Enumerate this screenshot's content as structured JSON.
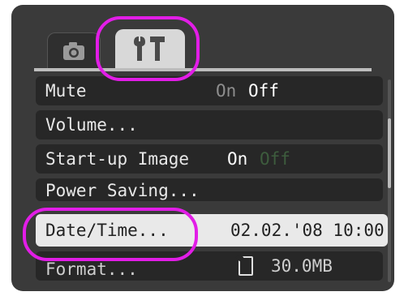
{
  "tabs": [
    {
      "icon": "camera-icon",
      "active": false
    },
    {
      "icon": "tools-icon",
      "active": true
    }
  ],
  "menu": {
    "rows": [
      {
        "label": "Mute",
        "option_a": "On",
        "option_b": "Off"
      },
      {
        "label": "Volume..."
      },
      {
        "label": "Start-up Image",
        "option_a": "On",
        "option_b": "Off"
      },
      {
        "label": "Power Saving..."
      },
      {
        "label": "Date/Time...",
        "value": "02.02.'08 10:00"
      },
      {
        "label": "Format...",
        "value": "30.0MB",
        "icon": "memory-card-icon"
      }
    ]
  },
  "colors": {
    "highlight": "#e21de7",
    "selected_row_bg": "#e9e9e9",
    "row_bg": "#272727",
    "screen_bg": "#3a3a3a"
  }
}
